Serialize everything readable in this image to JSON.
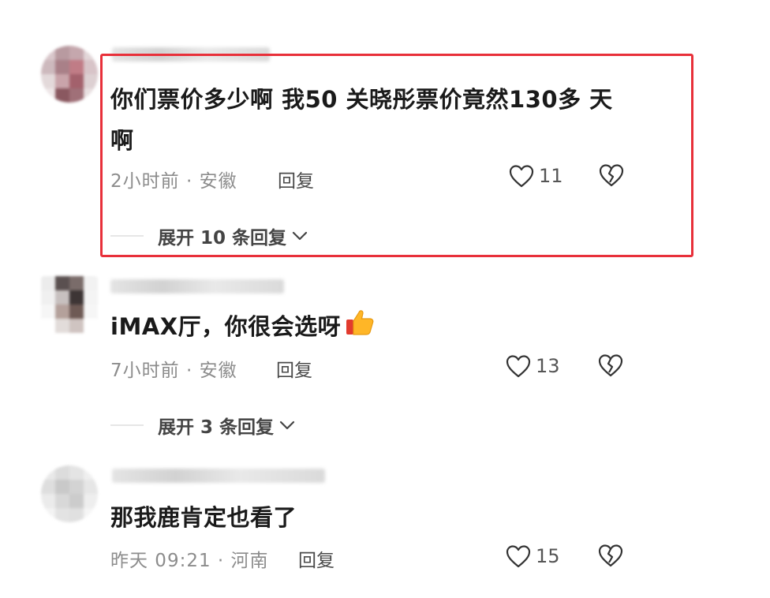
{
  "comments": [
    {
      "text_line1": "你们票价多少啊 我50  关晓彤票价竟然130多 天",
      "text_line2": "啊",
      "meta": "2小时前 · 安徽",
      "reply_label": "回复",
      "likes": "11",
      "expand_label": "展开 10 条回复"
    },
    {
      "text_line1": "iMAX厅，你很会选呀",
      "meta": "7小时前 · 安徽",
      "reply_label": "回复",
      "likes": "13",
      "expand_label": "展开 3 条回复"
    },
    {
      "text_line1": "那我鹿肯定也看了",
      "meta": "昨天 09:21 · 河南",
      "reply_label": "回复",
      "likes": "15"
    }
  ],
  "colors": {
    "highlight_border": "#e8303a",
    "meta_text": "#8c8c8c"
  },
  "icons": {
    "like": "heart-outline-icon",
    "dislike": "broken-heart-icon",
    "expand": "chevron-down-icon",
    "emoji": "thumbs-up-emoji"
  }
}
